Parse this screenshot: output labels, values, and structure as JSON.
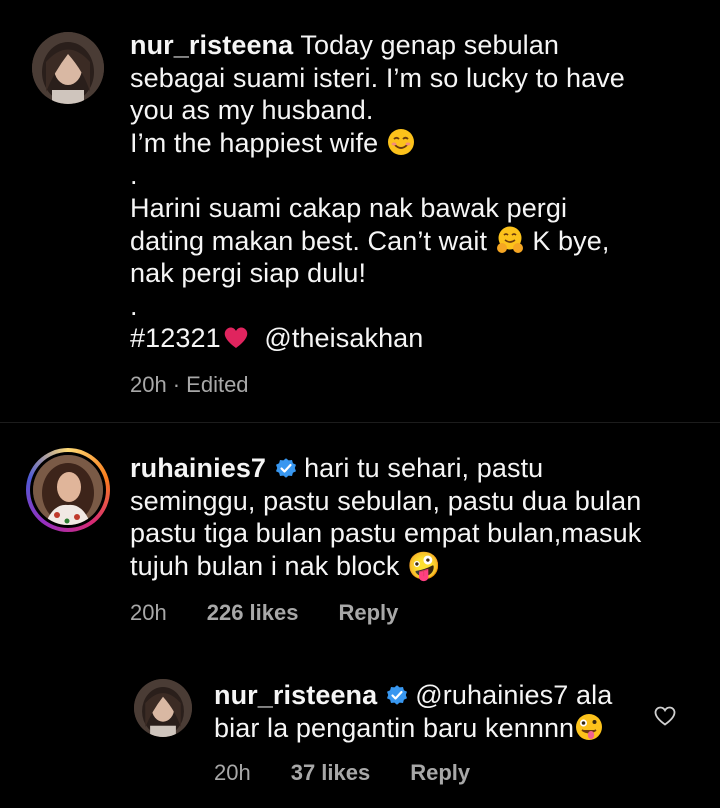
{
  "post": {
    "username": "nur_risteena",
    "caption_lines": [
      "Today genap sebulan",
      "sebagai suami isteri. I’m so lucky to have",
      "you as my husband.",
      "I’m the happiest wife",
      ".",
      "Harini suami cakap nak bawak pergi",
      "dating makan best. Can’t wait",
      "K bye,",
      "nak pergi siap dulu!",
      ".",
      "#12321",
      "@theisakhan"
    ],
    "time": "20h",
    "edited": "· Edited"
  },
  "comment1": {
    "username": "ruhainies7",
    "text_lines": [
      "hari tu sehari, pastu",
      "seminggu, pastu sebulan, pastu dua bulan",
      "pastu tiga bulan pastu empat bulan,masuk",
      "tujuh bulan i nak block 🤪"
    ],
    "time": "20h",
    "likes": "226 likes",
    "reply": "Reply"
  },
  "reply1": {
    "username": "nur_risteena",
    "text_lines": [
      "@ruhainies7 ala",
      "biar la pengantin baru kennnn"
    ],
    "time": "20h",
    "likes": "37 likes",
    "reply": "Reply"
  },
  "icons": {
    "verified": "verified-badge-icon",
    "like": "heart-outline-icon",
    "smile_emoji": "smiling-face-emoji",
    "hug_emoji": "hugging-face-emoji",
    "heart_emoji": "red-heart-emoji",
    "zany_emoji": "zany-face-emoji"
  },
  "colors": {
    "background": "#000000",
    "text": "#f5f5f5",
    "meta": "#a8a8a8",
    "verified": "#3897f0",
    "heart": "#e0245e"
  }
}
